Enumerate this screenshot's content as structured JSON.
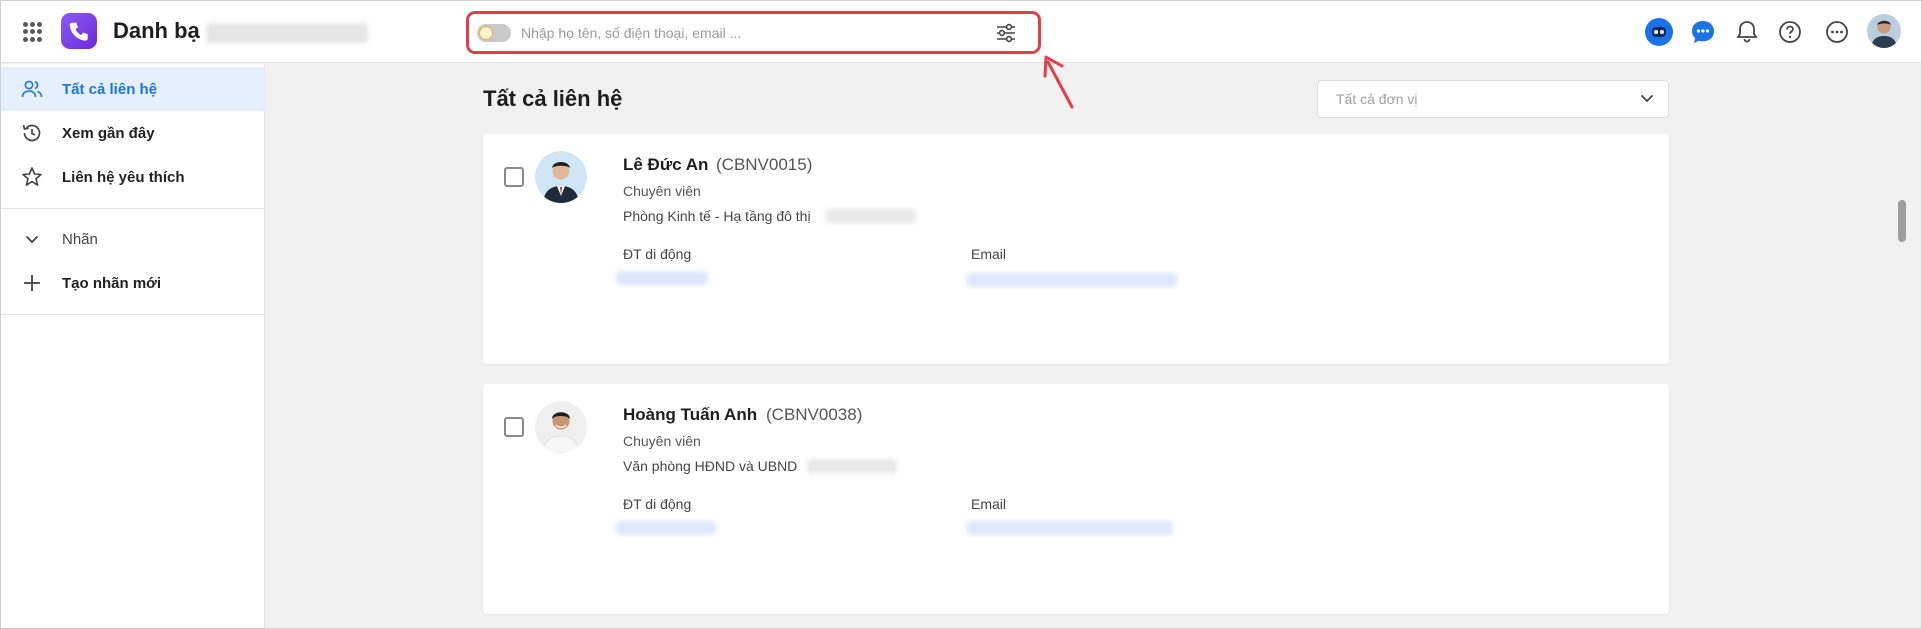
{
  "header": {
    "app_title": "Danh bạ",
    "search_placeholder": "Nhập họ tên, số điện thoại, email ..."
  },
  "icons": {
    "apps": "apps-grid-icon",
    "logo": "phone-logo-icon",
    "filter": "sliders-icon",
    "bot": "bot-icon",
    "chat": "chat-icon",
    "bell": "bell-icon",
    "help": "help-icon",
    "more": "more-icon"
  },
  "sidebar": {
    "items": [
      {
        "label": "Tất cả liên hệ",
        "icon": "contacts-icon"
      },
      {
        "label": "Xem gần đây",
        "icon": "history-icon"
      },
      {
        "label": "Liên hệ yêu thích",
        "icon": "star-icon"
      },
      {
        "label": "Nhãn",
        "icon": "chevron-down-icon"
      },
      {
        "label": "Tạo nhãn mới",
        "icon": "plus-icon"
      }
    ]
  },
  "main": {
    "title": "Tất cả liên hệ",
    "unit_filter_placeholder": "Tất cả đơn vị"
  },
  "contacts": [
    {
      "name": "Lê Đức An",
      "code": "(CBNV0015)",
      "role": "Chuyên viên",
      "department": "Phòng Kinh tế - Hạ tầng đô thị",
      "phone_label": "ĐT di động",
      "email_label": "Email"
    },
    {
      "name": "Hoàng Tuấn Anh",
      "code": "(CBNV0038)",
      "role": "Chuyên viên",
      "department": "Văn phòng HĐND và UBND",
      "phone_label": "ĐT di động",
      "email_label": "Email"
    }
  ],
  "colors": {
    "accent": "#1a73e8",
    "highlight": "#e43d4c",
    "logo": "#7c3aed"
  }
}
